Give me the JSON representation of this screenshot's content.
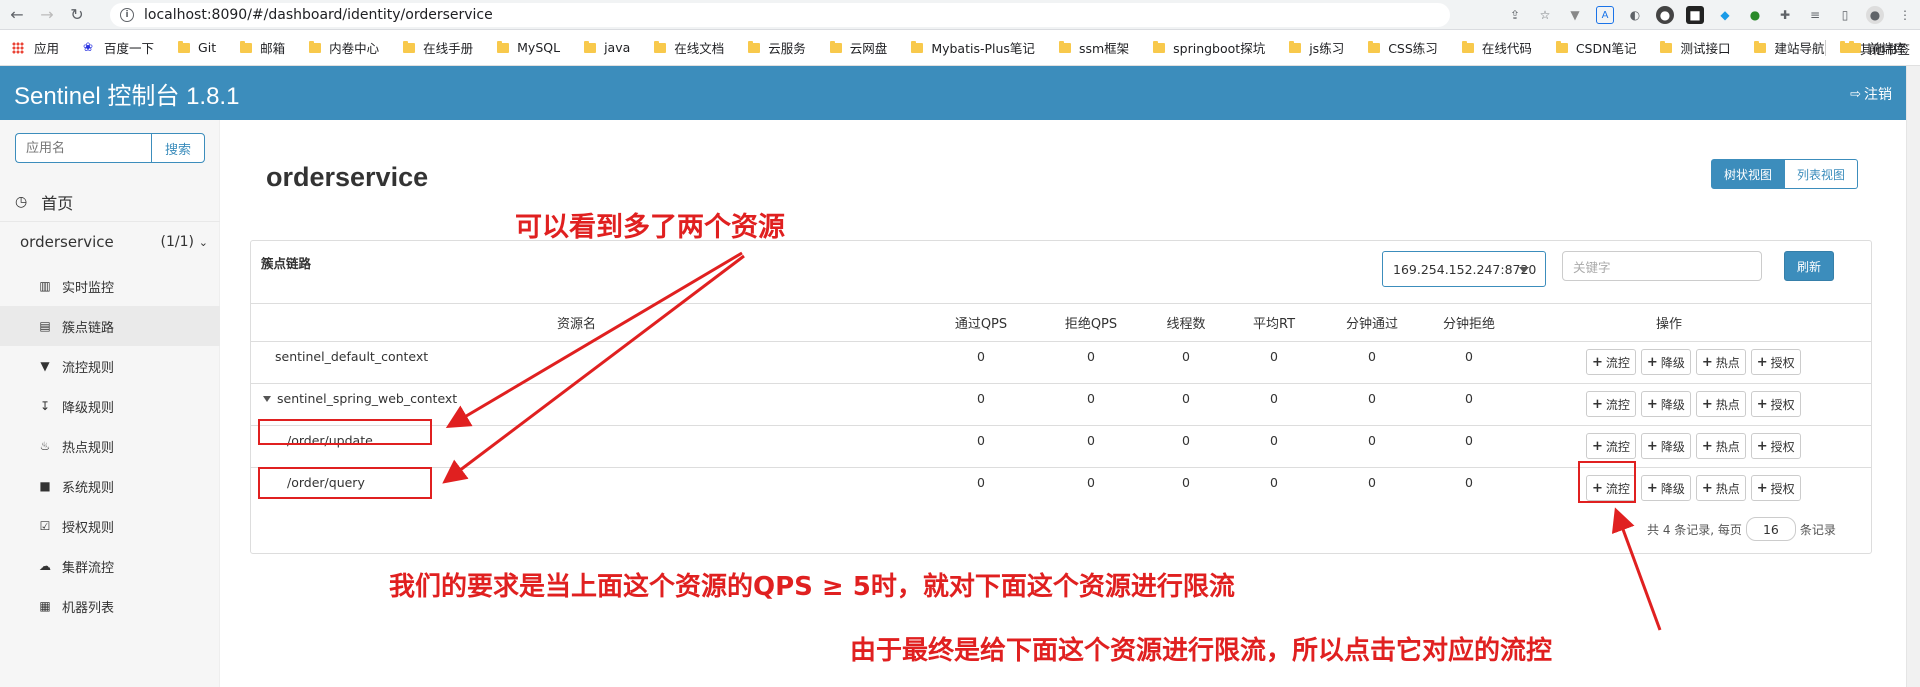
{
  "browser": {
    "url": "localhost:8090/#/dashboard/identity/orderservice",
    "bookmarks": [
      "应用",
      "百度一下",
      "Git",
      "邮箱",
      "内卷中心",
      "在线手册",
      "MySQL",
      "java",
      "在线文档",
      "云服务",
      "云网盘",
      "Mybatis-Plus笔记",
      "ssm框架",
      "springboot探坑",
      "js练习",
      "CSS练习",
      "在线代码",
      "CSDN笔记",
      "测试接口",
      "建站导航",
      "前端库"
    ],
    "other_bookmarks": "其他书签"
  },
  "header": {
    "title": "Sentinel 控制台 1.8.1",
    "logout": "注销"
  },
  "sidebar": {
    "search_placeholder": "应用名",
    "search_button": "搜索",
    "home": "首页",
    "app_name": "orderservice",
    "app_count": "(1/1)",
    "items": [
      {
        "label": "实时监控",
        "icon": "bar-chart-icon"
      },
      {
        "label": "簇点链路",
        "icon": "list-icon"
      },
      {
        "label": "流控规则",
        "icon": "filter-icon"
      },
      {
        "label": "降级规则",
        "icon": "arrow-down-icon"
      },
      {
        "label": "热点规则",
        "icon": "fire-icon"
      },
      {
        "label": "系统规则",
        "icon": "lock-icon"
      },
      {
        "label": "授权规则",
        "icon": "check-square-icon"
      },
      {
        "label": "集群流控",
        "icon": "cloud-icon"
      },
      {
        "label": "机器列表",
        "icon": "th-list-icon"
      }
    ]
  },
  "main": {
    "title": "orderservice",
    "view_tree": "树状视图",
    "view_list": "列表视图",
    "panel_title": "簇点链路",
    "machine": "169.254.152.247:8720",
    "keyword_placeholder": "关键字",
    "refresh": "刷新",
    "columns": [
      "资源名",
      "通过QPS",
      "拒绝QPS",
      "线程数",
      "平均RT",
      "分钟通过",
      "分钟拒绝",
      "操作"
    ],
    "actions": [
      "流控",
      "降级",
      "热点",
      "授权"
    ],
    "rows": [
      {
        "name": "sentinel_default_context",
        "values": [
          "0",
          "0",
          "0",
          "0",
          "0",
          "0"
        ]
      },
      {
        "name": "sentinel_spring_web_context",
        "values": [
          "0",
          "0",
          "0",
          "0",
          "0",
          "0"
        ]
      },
      {
        "name": "/order/update",
        "values": [
          "0",
          "0",
          "0",
          "0",
          "0",
          "0"
        ]
      },
      {
        "name": "/order/query",
        "values": [
          "0",
          "0",
          "0",
          "0",
          "0",
          "0"
        ]
      }
    ],
    "pager_prefix": "共 4 条记录, 每页",
    "page_size": "16",
    "pager_suffix": "条记录"
  },
  "annotations": {
    "top": "可以看到多了两个资源",
    "middle": "我们的要求是当上面这个资源的QPS ≥ 5时，就对下面这个资源进行限流",
    "bottom": "由于最终是给下面这个资源进行限流，所以点击它对应的流控",
    "color": "#e02020"
  }
}
